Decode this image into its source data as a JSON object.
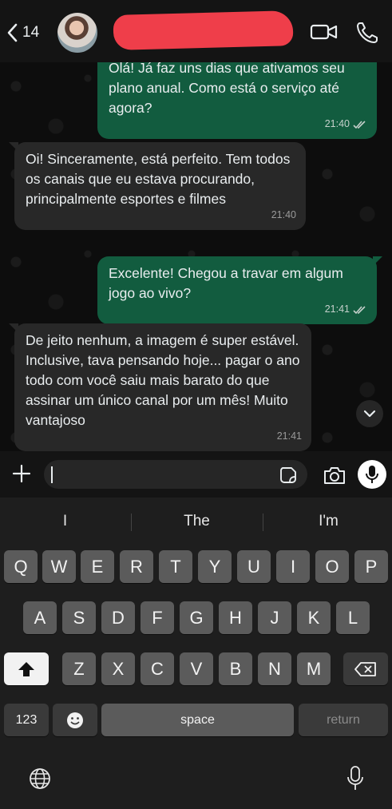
{
  "header": {
    "back_count": "14",
    "contact_name": "",
    "name_redacted": true,
    "icons": [
      "chevron-left-icon",
      "video-call-icon",
      "phone-icon"
    ]
  },
  "messages": [
    {
      "direction": "outgoing",
      "text": "Olá! Já faz uns dias que ativamos seu plano anual. Como está o serviço até agora?",
      "time": "21:40",
      "status": "read"
    },
    {
      "direction": "incoming",
      "text": "Oi! Sinceramente, está perfeito. Tem todos os canais que eu estava procurando, principalmente esportes e filmes",
      "time": "21:40"
    },
    {
      "direction": "outgoing",
      "text": "Excelente! Chegou a travar em algum jogo ao vivo?",
      "time": "21:41",
      "status": "read"
    },
    {
      "direction": "incoming",
      "text": "De jeito nenhum, a imagem é super estável. Inclusive, tava pensando hoje... pagar o ano todo com você saiu mais barato do que assinar um único canal por um mês! Muito vantajoso",
      "time": "21:41"
    }
  ],
  "composer": {
    "value": "",
    "placeholder": ""
  },
  "keyboard": {
    "suggestions": [
      "I",
      "The",
      "I'm"
    ],
    "row1": [
      "Q",
      "W",
      "E",
      "R",
      "T",
      "Y",
      "U",
      "I",
      "O",
      "P"
    ],
    "row2": [
      "A",
      "S",
      "D",
      "F",
      "G",
      "H",
      "J",
      "K",
      "L"
    ],
    "row3": [
      "Z",
      "X",
      "C",
      "V",
      "B",
      "N",
      "M"
    ],
    "numbers_label": "123",
    "space_label": "space",
    "return_label": "return"
  },
  "colors": {
    "outgoing_bubble": "#125c3f",
    "incoming_bubble": "#282828",
    "header_bg": "#141414",
    "redaction": "#ef3e4a"
  }
}
